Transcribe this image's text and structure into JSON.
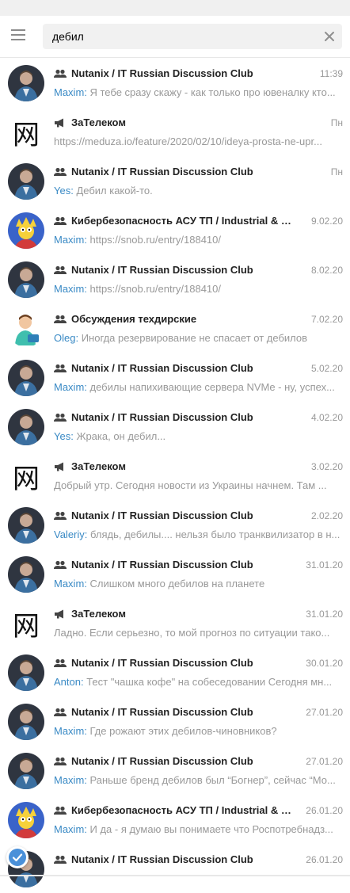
{
  "search": {
    "query": "дебил"
  },
  "results": [
    {
      "title": "Nutanix / IT Russian Discussion Club",
      "kind": "group",
      "avatar": "hero",
      "date": "11:39",
      "sender": "Maxim:",
      "text": " Я тебе сразу скажу - как только про ювеналку кто..."
    },
    {
      "title": "ЗаТелеком",
      "kind": "channel",
      "avatar": "glyph",
      "date": "Пн",
      "sender": "",
      "text": "https://meduza.io/feature/2020/02/10/ideya-prosta-ne-upr..."
    },
    {
      "title": "Nutanix / IT Russian Discussion Club",
      "kind": "group",
      "avatar": "hero",
      "date": "Пн",
      "sender": "Yes:",
      "text": " Дебил какой-то."
    },
    {
      "title": "Кибербезопасность АСУ ТП / Industrial & IIo...",
      "kind": "group",
      "avatar": "cartoon",
      "date": "9.02.20",
      "sender": "Maxim:",
      "text": " https://snob.ru/entry/188410/"
    },
    {
      "title": "Nutanix / IT Russian Discussion Club",
      "kind": "group",
      "avatar": "hero",
      "date": "8.02.20",
      "sender": "Maxim:",
      "text": " https://snob.ru/entry/188410/"
    },
    {
      "title": "Обсуждения техдирские",
      "kind": "group",
      "avatar": "person",
      "date": "7.02.20",
      "sender": "Oleg:",
      "text": " Иногда резервирование не спасает от дебилов"
    },
    {
      "title": "Nutanix / IT Russian Discussion Club",
      "kind": "group",
      "avatar": "hero",
      "date": "5.02.20",
      "sender": "Maxim:",
      "text": " дебилы напихивающие сервера NVMe - ну, успех..."
    },
    {
      "title": "Nutanix / IT Russian Discussion Club",
      "kind": "group",
      "avatar": "hero",
      "date": "4.02.20",
      "sender": "Yes:",
      "text": " Жрака, он дебил..."
    },
    {
      "title": "ЗаТелеком",
      "kind": "channel",
      "avatar": "glyph",
      "date": "3.02.20",
      "sender": "",
      "text": "Добрый утр.  Сегодня новости из Украины начнем. Там ..."
    },
    {
      "title": "Nutanix / IT Russian Discussion Club",
      "kind": "group",
      "avatar": "hero",
      "date": "2.02.20",
      "sender": "Valeriy:",
      "text": " блядь, дебилы.... нельзя было транквилизатор в н..."
    },
    {
      "title": "Nutanix / IT Russian Discussion Club",
      "kind": "group",
      "avatar": "hero",
      "date": "31.01.20",
      "sender": "Maxim:",
      "text": " Слишком много дебилов на планете"
    },
    {
      "title": "ЗаТелеком",
      "kind": "channel",
      "avatar": "glyph",
      "date": "31.01.20",
      "sender": "",
      "text": "Ладно. Если серьезно, то мой прогноз по ситуации тако..."
    },
    {
      "title": "Nutanix / IT Russian Discussion Club",
      "kind": "group",
      "avatar": "hero",
      "date": "30.01.20",
      "sender": "Anton:",
      "text": " Тест \"чашка кофе\" на собеседовании  Сегодня мн..."
    },
    {
      "title": "Nutanix / IT Russian Discussion Club",
      "kind": "group",
      "avatar": "hero",
      "date": "27.01.20",
      "sender": "Maxim:",
      "text": " Где рожают этих дебилов-чиновников?"
    },
    {
      "title": "Nutanix / IT Russian Discussion Club",
      "kind": "group",
      "avatar": "hero",
      "date": "27.01.20",
      "sender": "Maxim:",
      "text": " Раньше бренд дебилов был “Богнер”, сейчас “Мо..."
    },
    {
      "title": "Кибербезопасность АСУ ТП / Industrial & II...",
      "kind": "group",
      "avatar": "cartoon",
      "date": "26.01.20",
      "sender": "Maxim:",
      "text": " И да - я думаю вы понимаете что Роспотребнадз..."
    },
    {
      "title": "Nutanix / IT Russian Discussion Club",
      "kind": "group",
      "avatar": "hero",
      "date": "26.01.20",
      "sender": "",
      "text": ""
    }
  ],
  "glyph_char": "网",
  "colors": {
    "sender": "#3a8ac5",
    "badge": "#4a90d9",
    "hero_bg": "#2f3540"
  }
}
